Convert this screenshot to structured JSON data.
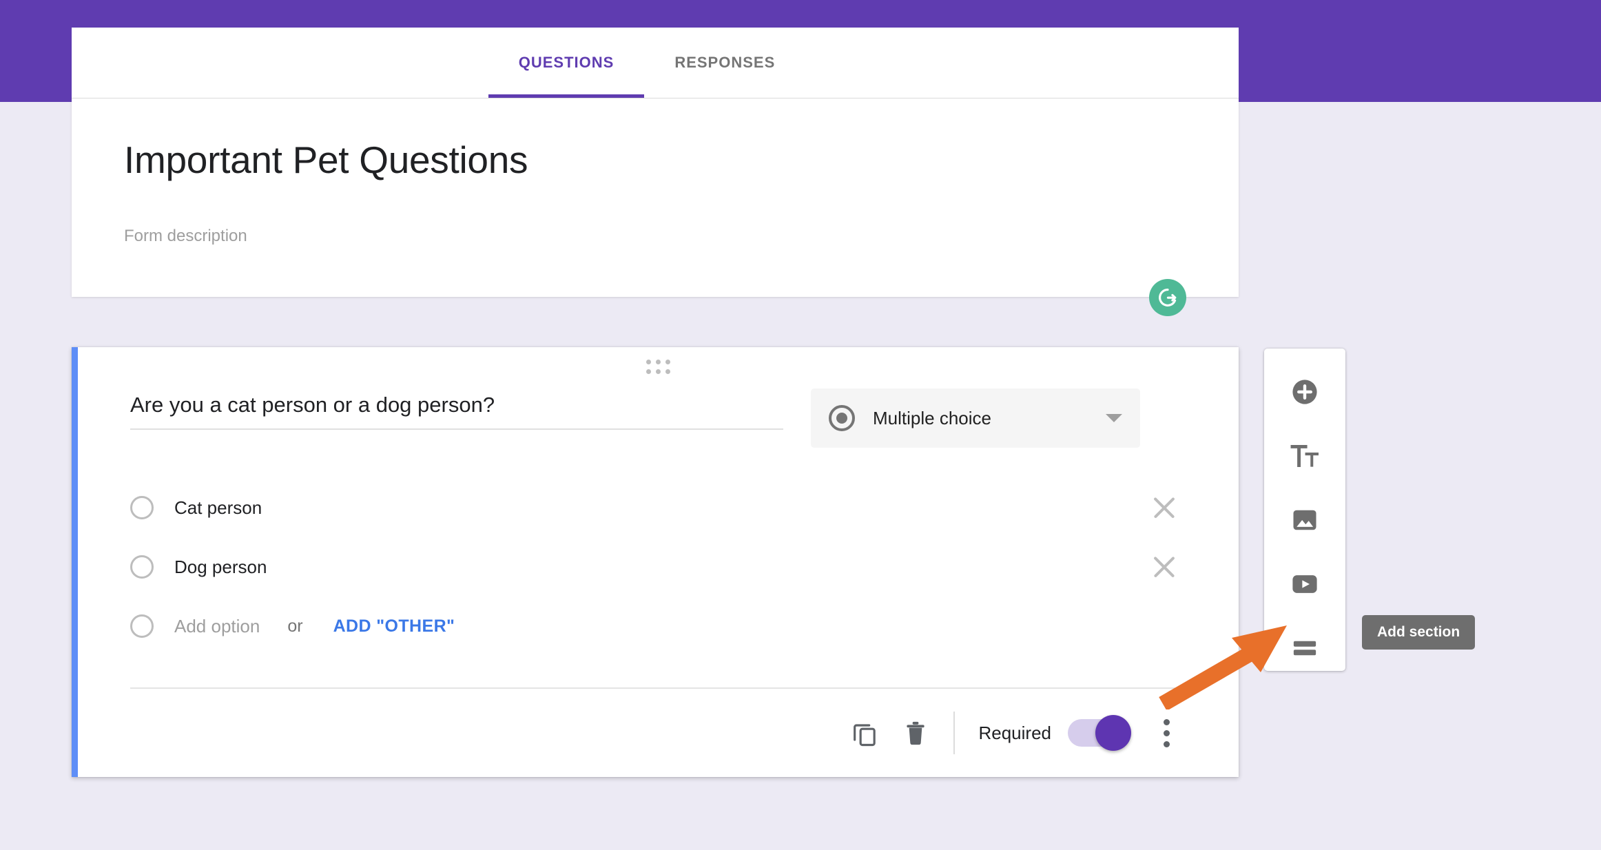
{
  "theme": {
    "header_purple": "#5F3CB0",
    "page_background": "#ECEAF4",
    "accent_blue": "#5E8EF7",
    "link_blue": "#3B78E7",
    "toggle_purple": "#5E35B1",
    "grammarly_green": "#4FB996",
    "annotation_orange": "#E8702A"
  },
  "tabs": [
    {
      "label": "QUESTIONS",
      "active": true
    },
    {
      "label": "RESPONSES",
      "active": false
    }
  ],
  "form": {
    "title": "Important Pet Questions",
    "description_placeholder": "Form description"
  },
  "question": {
    "text": "Are you a cat person or a dog person?",
    "type_label": "Multiple choice",
    "options": [
      {
        "label": "Cat person"
      },
      {
        "label": "Dog person"
      }
    ],
    "add_option_placeholder": "Add option",
    "or_label": "or",
    "add_other_label": "ADD \"OTHER\"",
    "required_label": "Required",
    "required_on": true
  },
  "side_toolbar": {
    "items": [
      {
        "icon": "add-question-icon",
        "name": "add-question"
      },
      {
        "icon": "add-title-icon",
        "name": "add-title-and-description"
      },
      {
        "icon": "add-image-icon",
        "name": "add-image"
      },
      {
        "icon": "add-video-icon",
        "name": "add-video"
      },
      {
        "icon": "add-section-icon",
        "name": "add-section"
      }
    ]
  },
  "tooltip": {
    "text": "Add section"
  }
}
